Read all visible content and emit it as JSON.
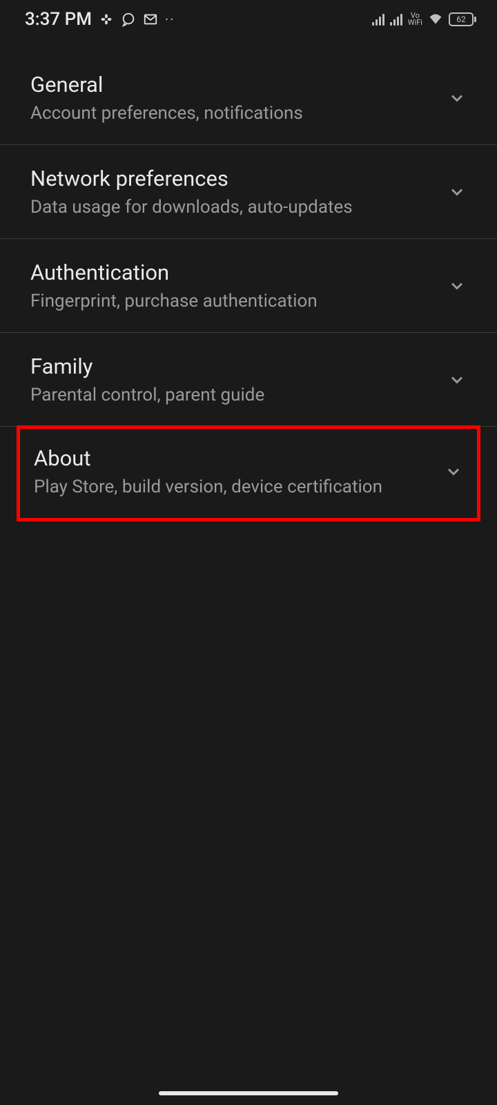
{
  "statusBar": {
    "time": "3:37 PM",
    "battery": "62",
    "voWifiTop": "Vo",
    "voWifiBottom": "WiFi"
  },
  "settings": {
    "items": [
      {
        "title": "General",
        "subtitle": "Account preferences, notifications"
      },
      {
        "title": "Network preferences",
        "subtitle": "Data usage for downloads, auto-updates"
      },
      {
        "title": "Authentication",
        "subtitle": "Fingerprint, purchase authentication"
      },
      {
        "title": "Family",
        "subtitle": "Parental control, parent guide"
      },
      {
        "title": "About",
        "subtitle": "Play Store, build version, device certification"
      }
    ]
  }
}
